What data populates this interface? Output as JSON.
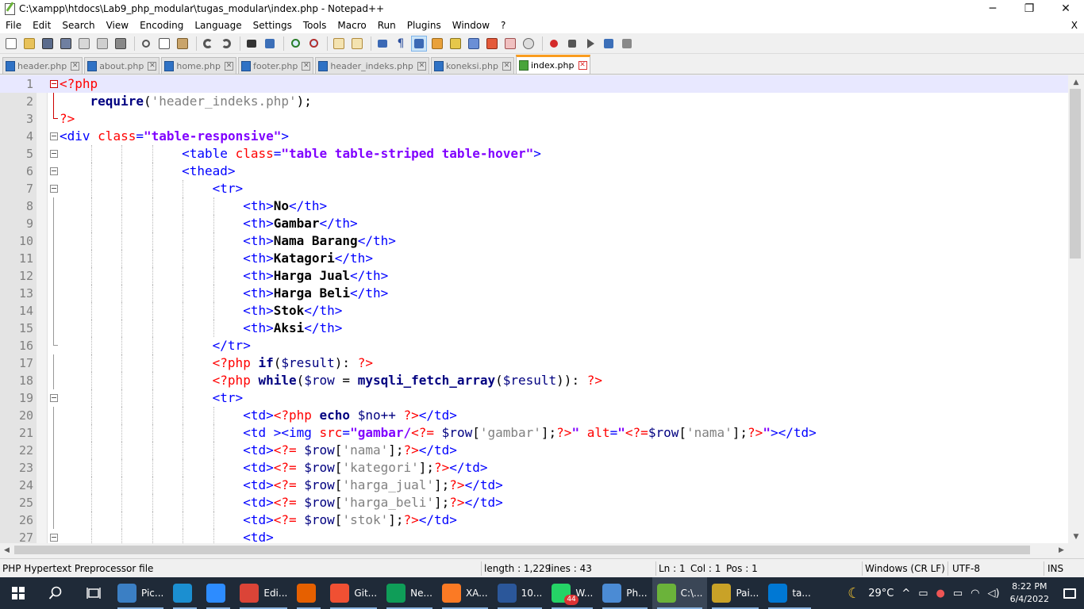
{
  "window": {
    "title": "C:\\xampp\\htdocs\\Lab9_php_modular\\tugas_modular\\index.php - Notepad++",
    "minimize": "─",
    "restore": "❐",
    "close": "✕"
  },
  "menu": {
    "items": [
      "File",
      "Edit",
      "Search",
      "View",
      "Encoding",
      "Language",
      "Settings",
      "Tools",
      "Macro",
      "Run",
      "Plugins",
      "Window",
      "?"
    ],
    "close_doc": "X"
  },
  "toolbar": {
    "icons": [
      "new-file-icon",
      "open-file-icon",
      "save-icon",
      "save-all-icon",
      "close-icon",
      "close-all-icon",
      "print-icon",
      "cut-icon",
      "copy-icon",
      "paste-icon",
      "undo-icon",
      "redo-icon",
      "find-icon",
      "replace-icon",
      "zoom-in-icon",
      "zoom-out-icon",
      "sync-vertical-icon",
      "sync-horizontal-icon",
      "word-wrap-icon",
      "all-characters-icon",
      "indent-guide-icon",
      "udl-icon",
      "doc-map-icon",
      "function-list-icon",
      "folder-workspace-icon",
      "monitoring-icon",
      "record-macro-icon",
      "stop-macro-icon",
      "play-macro-icon",
      "run-macro-multiple-icon",
      "save-macro-icon"
    ]
  },
  "tabs": [
    {
      "label": "header.php",
      "active": false
    },
    {
      "label": "about.php",
      "active": false
    },
    {
      "label": "home.php",
      "active": false
    },
    {
      "label": "footer.php",
      "active": false
    },
    {
      "label": "header_indeks.php",
      "active": false
    },
    {
      "label": "koneksi.php",
      "active": false
    },
    {
      "label": "index.php",
      "active": true
    }
  ],
  "editor": {
    "lines": [
      {
        "n": "1",
        "tokens": [
          [
            "php",
            "<?php"
          ]
        ]
      },
      {
        "n": "2",
        "tokens": [
          [
            "plain",
            "    "
          ],
          [
            "kw",
            "require"
          ],
          [
            "plain",
            "("
          ],
          [
            "pstr",
            "'header_indeks.php'"
          ],
          [
            "plain",
            ");"
          ]
        ]
      },
      {
        "n": "3",
        "tokens": [
          [
            "php",
            "?>"
          ]
        ]
      },
      {
        "n": "4",
        "tokens": [
          [
            "tag",
            "<div "
          ],
          [
            "attr",
            "class"
          ],
          [
            "tag",
            "="
          ],
          [
            "str",
            "\"table-responsive\""
          ],
          [
            "tag",
            ">"
          ]
        ]
      },
      {
        "n": "5",
        "tokens": [
          [
            "plain",
            "                "
          ],
          [
            "tag",
            "<table "
          ],
          [
            "attr",
            "class"
          ],
          [
            "tag",
            "="
          ],
          [
            "str",
            "\"table table-striped table-hover\""
          ],
          [
            "tag",
            ">"
          ]
        ]
      },
      {
        "n": "6",
        "tokens": [
          [
            "plain",
            "                "
          ],
          [
            "tag",
            "<thead>"
          ]
        ]
      },
      {
        "n": "7",
        "tokens": [
          [
            "plain",
            "                    "
          ],
          [
            "tag",
            "<tr>"
          ]
        ]
      },
      {
        "n": "8",
        "tokens": [
          [
            "plain",
            "                        "
          ],
          [
            "tag",
            "<th>"
          ],
          [
            "txt",
            "No"
          ],
          [
            "tag",
            "</th>"
          ]
        ]
      },
      {
        "n": "9",
        "tokens": [
          [
            "plain",
            "                        "
          ],
          [
            "tag",
            "<th>"
          ],
          [
            "txt",
            "Gambar"
          ],
          [
            "tag",
            "</th>"
          ]
        ]
      },
      {
        "n": "10",
        "tokens": [
          [
            "plain",
            "                        "
          ],
          [
            "tag",
            "<th>"
          ],
          [
            "txt",
            "Nama Barang"
          ],
          [
            "tag",
            "</th>"
          ]
        ]
      },
      {
        "n": "11",
        "tokens": [
          [
            "plain",
            "                        "
          ],
          [
            "tag",
            "<th>"
          ],
          [
            "txt",
            "Katagori"
          ],
          [
            "tag",
            "</th>"
          ]
        ]
      },
      {
        "n": "12",
        "tokens": [
          [
            "plain",
            "                        "
          ],
          [
            "tag",
            "<th>"
          ],
          [
            "txt",
            "Harga Jual"
          ],
          [
            "tag",
            "</th>"
          ]
        ]
      },
      {
        "n": "13",
        "tokens": [
          [
            "plain",
            "                        "
          ],
          [
            "tag",
            "<th>"
          ],
          [
            "txt",
            "Harga Beli"
          ],
          [
            "tag",
            "</th>"
          ]
        ]
      },
      {
        "n": "14",
        "tokens": [
          [
            "plain",
            "                        "
          ],
          [
            "tag",
            "<th>"
          ],
          [
            "txt",
            "Stok"
          ],
          [
            "tag",
            "</th>"
          ]
        ]
      },
      {
        "n": "15",
        "tokens": [
          [
            "plain",
            "                        "
          ],
          [
            "tag",
            "<th>"
          ],
          [
            "txt",
            "Aksi"
          ],
          [
            "tag",
            "</th>"
          ]
        ]
      },
      {
        "n": "16",
        "tokens": [
          [
            "plain",
            "                    "
          ],
          [
            "tag",
            "</tr>"
          ]
        ]
      },
      {
        "n": "17",
        "tokens": [
          [
            "plain",
            "                    "
          ],
          [
            "php",
            "<?php "
          ],
          [
            "kw",
            "if"
          ],
          [
            "plain",
            "("
          ],
          [
            "var",
            "$result"
          ],
          [
            "plain",
            "): "
          ],
          [
            "php",
            "?>"
          ]
        ]
      },
      {
        "n": "18",
        "tokens": [
          [
            "plain",
            "                    "
          ],
          [
            "php",
            "<?php "
          ],
          [
            "kw",
            "while"
          ],
          [
            "plain",
            "("
          ],
          [
            "var",
            "$row"
          ],
          [
            "plain",
            " = "
          ],
          [
            "fn",
            "mysqli_fetch_array"
          ],
          [
            "plain",
            "("
          ],
          [
            "var",
            "$result"
          ],
          [
            "plain",
            ")): "
          ],
          [
            "php",
            "?>"
          ]
        ]
      },
      {
        "n": "19",
        "tokens": [
          [
            "plain",
            "                    "
          ],
          [
            "tag",
            "<tr>"
          ]
        ]
      },
      {
        "n": "20",
        "tokens": [
          [
            "plain",
            "                        "
          ],
          [
            "tag",
            "<td>"
          ],
          [
            "php",
            "<?php "
          ],
          [
            "kw",
            "echo"
          ],
          [
            "plain",
            " "
          ],
          [
            "var",
            "$no++"
          ],
          [
            "plain",
            " "
          ],
          [
            "php",
            "?>"
          ],
          [
            "tag",
            "</td>"
          ]
        ]
      },
      {
        "n": "21",
        "tokens": [
          [
            "plain",
            "                        "
          ],
          [
            "tag",
            "<td ><img "
          ],
          [
            "attr",
            "src"
          ],
          [
            "tag",
            "="
          ],
          [
            "str",
            "\"gambar/"
          ],
          [
            "php",
            "<?="
          ],
          [
            "plain",
            " "
          ],
          [
            "var",
            "$row"
          ],
          [
            "plain",
            "["
          ],
          [
            "pstr",
            "'gambar'"
          ],
          [
            "plain",
            "];"
          ],
          [
            "php",
            "?>"
          ],
          [
            "str",
            "\""
          ],
          [
            "plain",
            " "
          ],
          [
            "attr",
            "alt"
          ],
          [
            "tag",
            "="
          ],
          [
            "str",
            "\""
          ],
          [
            "php",
            "<?="
          ],
          [
            "var",
            "$row"
          ],
          [
            "plain",
            "["
          ],
          [
            "pstr",
            "'nama'"
          ],
          [
            "plain",
            "];"
          ],
          [
            "php",
            "?>"
          ],
          [
            "str",
            "\""
          ],
          [
            "tag",
            "></td>"
          ]
        ]
      },
      {
        "n": "22",
        "tokens": [
          [
            "plain",
            "                        "
          ],
          [
            "tag",
            "<td>"
          ],
          [
            "php",
            "<?="
          ],
          [
            "plain",
            " "
          ],
          [
            "var",
            "$row"
          ],
          [
            "plain",
            "["
          ],
          [
            "pstr",
            "'nama'"
          ],
          [
            "plain",
            "];"
          ],
          [
            "php",
            "?>"
          ],
          [
            "tag",
            "</td>"
          ]
        ]
      },
      {
        "n": "23",
        "tokens": [
          [
            "plain",
            "                        "
          ],
          [
            "tag",
            "<td>"
          ],
          [
            "php",
            "<?="
          ],
          [
            "plain",
            " "
          ],
          [
            "var",
            "$row"
          ],
          [
            "plain",
            "["
          ],
          [
            "pstr",
            "'kategori'"
          ],
          [
            "plain",
            "];"
          ],
          [
            "php",
            "?>"
          ],
          [
            "tag",
            "</td>"
          ]
        ]
      },
      {
        "n": "24",
        "tokens": [
          [
            "plain",
            "                        "
          ],
          [
            "tag",
            "<td>"
          ],
          [
            "php",
            "<?="
          ],
          [
            "plain",
            " "
          ],
          [
            "var",
            "$row"
          ],
          [
            "plain",
            "["
          ],
          [
            "pstr",
            "'harga_jual'"
          ],
          [
            "plain",
            "];"
          ],
          [
            "php",
            "?>"
          ],
          [
            "tag",
            "</td>"
          ]
        ]
      },
      {
        "n": "25",
        "tokens": [
          [
            "plain",
            "                        "
          ],
          [
            "tag",
            "<td>"
          ],
          [
            "php",
            "<?="
          ],
          [
            "plain",
            " "
          ],
          [
            "var",
            "$row"
          ],
          [
            "plain",
            "["
          ],
          [
            "pstr",
            "'harga_beli'"
          ],
          [
            "plain",
            "];"
          ],
          [
            "php",
            "?>"
          ],
          [
            "tag",
            "</td>"
          ]
        ]
      },
      {
        "n": "26",
        "tokens": [
          [
            "plain",
            "                        "
          ],
          [
            "tag",
            "<td>"
          ],
          [
            "php",
            "<?="
          ],
          [
            "plain",
            " "
          ],
          [
            "var",
            "$row"
          ],
          [
            "plain",
            "["
          ],
          [
            "pstr",
            "'stok'"
          ],
          [
            "plain",
            "];"
          ],
          [
            "php",
            "?>"
          ],
          [
            "tag",
            "</td>"
          ]
        ]
      },
      {
        "n": "27",
        "tokens": [
          [
            "plain",
            "                        "
          ],
          [
            "tag",
            "<td>"
          ]
        ]
      }
    ]
  },
  "status": {
    "file_type": "PHP Hypertext Preprocessor file",
    "length": "length : 1,229",
    "lines": "lines : 43",
    "ln": "Ln : 1",
    "col": "Col : 1",
    "pos": "Pos : 1",
    "eol": "Windows (CR LF)",
    "encoding": "UTF-8",
    "mode": "INS"
  },
  "taskbar": {
    "apps": [
      {
        "label": "Pic...",
        "icon": "photos-icon",
        "color": "#3b7fc4"
      },
      {
        "label": "",
        "icon": "edge-icon",
        "color": "#1b8fd1"
      },
      {
        "label": "",
        "icon": "zoom-icon",
        "color": "#2d8cff"
      },
      {
        "label": "Edi...",
        "icon": "chrome-icon",
        "color": "#db4437"
      },
      {
        "label": "",
        "icon": "firefox-icon",
        "color": "#e66000"
      },
      {
        "label": "Git...",
        "icon": "git-icon",
        "color": "#f05033"
      },
      {
        "label": "Ne...",
        "icon": "chrome-profile-icon",
        "color": "#0f9d58"
      },
      {
        "label": "XA...",
        "icon": "xampp-icon",
        "color": "#fb7a24"
      },
      {
        "label": "10...",
        "icon": "word-icon",
        "color": "#2b579a"
      },
      {
        "label": "W...",
        "icon": "whatsapp-icon",
        "color": "#25d366",
        "badge": "44"
      },
      {
        "label": "Ph...",
        "icon": "photo-viewer-icon",
        "color": "#4b8bd4"
      },
      {
        "label": "C:\\...",
        "icon": "notepadpp-icon",
        "color": "#6bb33a"
      },
      {
        "label": "Pai...",
        "icon": "paint-icon",
        "color": "#c9a227"
      },
      {
        "label": "ta...",
        "icon": "vscode-icon",
        "color": "#0078d4"
      }
    ],
    "weather": "29°C",
    "time": "8:22 PM",
    "date": "6/4/2022"
  }
}
